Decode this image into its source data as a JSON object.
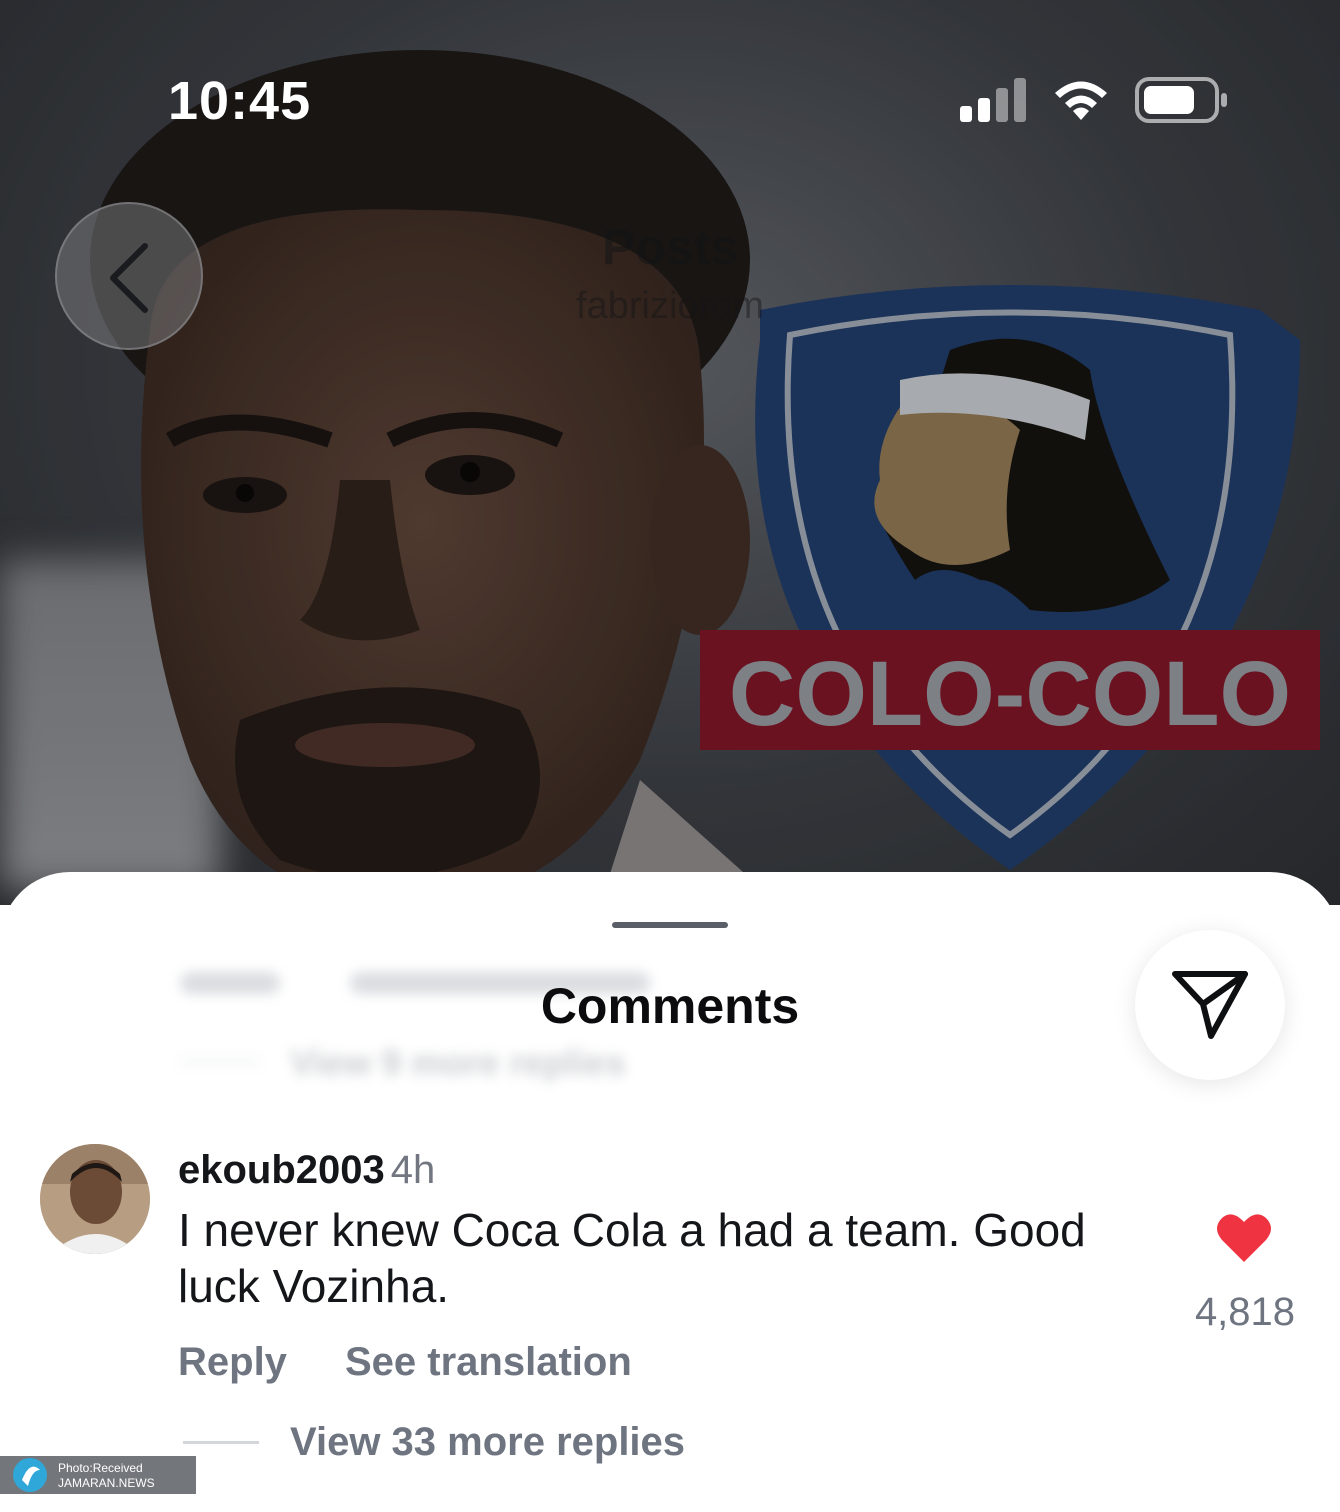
{
  "status_bar": {
    "time": "10:45"
  },
  "header": {
    "title": "Posts",
    "subtitle": "fabriziorom"
  },
  "image": {
    "crest_text": "COLO-COLO"
  },
  "comments_sheet": {
    "title": "Comments",
    "blurred_above": {
      "more_replies": "View 9 more replies"
    },
    "comment": {
      "username": "ekoub2003",
      "time": "4h",
      "text": "I never knew Coca Cola a had a team. Good luck Vozinha.",
      "like_count": "4,818",
      "reply_label": "Reply",
      "translation_label": "See translation",
      "more_replies": "View 33 more replies"
    }
  },
  "watermark": {
    "line1": "Photo:Received",
    "line2": "JAMARAN.NEWS"
  },
  "colors": {
    "like": "#ef3340",
    "crest_navy": "#1f3a66",
    "crest_band": "#7a1526"
  },
  "icons": [
    "back-chevron-icon",
    "signal-icon",
    "wifi-icon",
    "battery-icon",
    "send-icon",
    "heart-icon"
  ]
}
